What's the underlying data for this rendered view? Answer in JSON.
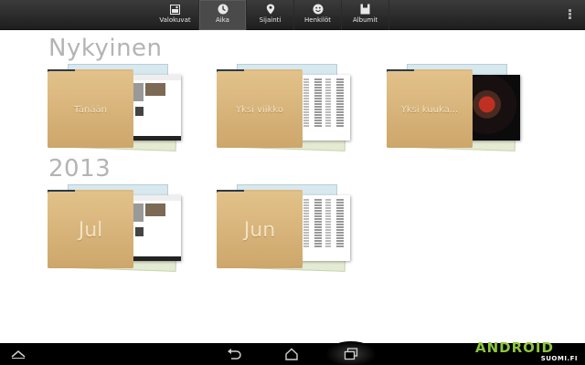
{
  "topbar": {
    "tabs": [
      {
        "label": "Valokuvat",
        "icon": "photo-icon",
        "active": false
      },
      {
        "label": "Aika",
        "icon": "clock-icon",
        "active": true
      },
      {
        "label": "Sijainti",
        "icon": "location-pin-icon",
        "active": false
      },
      {
        "label": "Henkilöt",
        "icon": "smiley-face-icon",
        "active": false
      },
      {
        "label": "Albumit",
        "icon": "album-icon",
        "active": false
      }
    ],
    "overflow_icon": "overflow-menu-icon"
  },
  "sections": [
    {
      "heading": "Nykyinen",
      "albums": [
        {
          "label": "Tänään",
          "thumb": "screenshot"
        },
        {
          "label": "Yksi viikko",
          "thumb": "list"
        },
        {
          "label": "Yksi kuuka...",
          "thumb": "poster"
        }
      ]
    },
    {
      "heading": "2013",
      "albums": [
        {
          "label": "Jul",
          "thumb": "screenshot"
        },
        {
          "label": "Jun",
          "thumb": "list"
        }
      ]
    }
  ],
  "navbar": {
    "buttons": [
      "hide-keyboard-icon",
      "back-icon",
      "home-icon",
      "recent-apps-icon"
    ]
  },
  "watermark": {
    "main": "ANDROID",
    "sub": "SUOMI.FI"
  },
  "colors": {
    "folder": "#d4b077",
    "heading": "#b4b4b4",
    "logo_green": "#8cc63f"
  }
}
